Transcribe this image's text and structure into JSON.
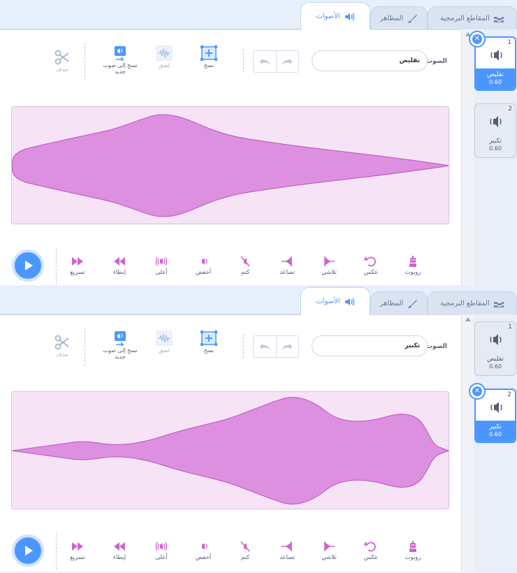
{
  "tabs": {
    "code": "المقاطع البرمجية",
    "costumes": "المظاهر",
    "sounds": "الأصوات"
  },
  "toolbar": {
    "sound_label": "الصوت",
    "copy": "نسخ",
    "paste": "لصق",
    "copy_to_new": "نسخ إلى صوت جديد",
    "delete": "حذف"
  },
  "effects": {
    "faster": "تسريع",
    "slower": "إبطاء",
    "louder": "أعلى",
    "softer": "أخفض",
    "mute": "كتم",
    "fade_in": "تصاعد",
    "fade_out": "تلاشي",
    "reverse": "عكس",
    "robot": "روبوت"
  },
  "sounds": [
    {
      "index": "1",
      "name": "تقليص",
      "duration": "0.60"
    },
    {
      "index": "2",
      "name": "تكبير",
      "duration": "0.60"
    }
  ],
  "panels": [
    {
      "current_name": "تقليص",
      "selected_index": 1
    },
    {
      "current_name": "تكبير",
      "selected_index": 2
    }
  ],
  "colors": {
    "accent": "#4c97ff",
    "sound_pink": "#cf63cf",
    "wave_fill": "#dd8fe0",
    "wave_bg": "#f6e4f6"
  }
}
